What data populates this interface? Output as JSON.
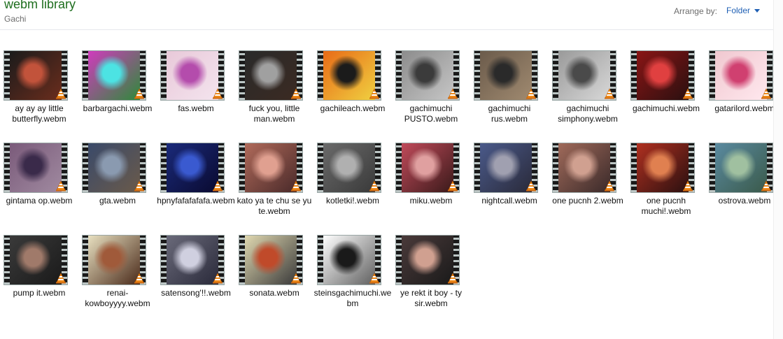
{
  "header": {
    "title": "webm library",
    "subtitle": "Gachi",
    "arrange_label": "Arrange by:",
    "arrange_value": "Folder"
  },
  "items": [
    {
      "label": "ay ay ay little butterfly.webm",
      "colors": [
        "#1b1b1b",
        "#c2533b",
        "#6b2d1d"
      ]
    },
    {
      "label": "barbargachi.webm",
      "colors": [
        "#d03bbd",
        "#4ce3e3",
        "#2e8a3a"
      ]
    },
    {
      "label": "fas.webm",
      "colors": [
        "#e8c9d9",
        "#b44cac",
        "#f4e4ee"
      ]
    },
    {
      "label": "fuck you, little man.webm",
      "colors": [
        "#2a2a2a",
        "#a0a0a0",
        "#3b2a22"
      ]
    },
    {
      "label": "gachileach.webm",
      "colors": [
        "#e86a17",
        "#1b1b1b",
        "#f0d040"
      ]
    },
    {
      "label": "gachimuchi PUSTO.webm",
      "colors": [
        "#8c8c8c",
        "#3b3b3b",
        "#c6c6c6"
      ]
    },
    {
      "label": "gachimuchi rus.webm",
      "colors": [
        "#6b5b4b",
        "#2a2a2a",
        "#a08a70"
      ]
    },
    {
      "label": "gachimuchi simphony.webm",
      "colors": [
        "#9a9a9a",
        "#4a4a4a",
        "#d8d8d8"
      ]
    },
    {
      "label": "gachimuchi.webm",
      "colors": [
        "#8a1515",
        "#e04040",
        "#2a1010"
      ]
    },
    {
      "label": "gatarilord.webm",
      "colors": [
        "#f0c8d0",
        "#d04070",
        "#ffe8ee"
      ]
    },
    {
      "label": "gintama op.webm",
      "colors": [
        "#7a5a7a",
        "#3a2a4a",
        "#a08aa0"
      ]
    },
    {
      "label": "gta.webm",
      "colors": [
        "#3a4a6a",
        "#8a9ab0",
        "#6a5a4a"
      ]
    },
    {
      "label": "hpnyfafafafafa.webm",
      "colors": [
        "#1a2a7a",
        "#3a5ad0",
        "#0a0a30"
      ]
    },
    {
      "label": "kato ya te chu se yu te.webm",
      "colors": [
        "#b06a5a",
        "#e0a090",
        "#4a2a2a"
      ]
    },
    {
      "label": "kotletki!.webm",
      "colors": [
        "#6a6a6a",
        "#b0b0b0",
        "#3a3a3a"
      ]
    },
    {
      "label": "miku.webm",
      "colors": [
        "#c04a5a",
        "#e0a0a0",
        "#3a1a1a"
      ]
    },
    {
      "label": "nightcall.webm",
      "colors": [
        "#4a5a8a",
        "#a0a0b0",
        "#2a2a3a"
      ]
    },
    {
      "label": "one pucnh 2.webm",
      "colors": [
        "#a06a5a",
        "#d0a090",
        "#3a2a2a"
      ]
    },
    {
      "label": "one pucnh muchi!.webm",
      "colors": [
        "#b03020",
        "#e08050",
        "#2a1010"
      ]
    },
    {
      "label": "ostrova.webm",
      "colors": [
        "#5a8aa0",
        "#a0c0a0",
        "#3a5a4a"
      ]
    },
    {
      "label": "pump it.webm",
      "colors": [
        "#3a3a3a",
        "#a07a6a",
        "#1a1a1a"
      ]
    },
    {
      "label": "renai-kowboyyyy.webm",
      "colors": [
        "#e8e0c0",
        "#a05a3a",
        "#4a2a1a"
      ]
    },
    {
      "label": "satensong'!!.webm",
      "colors": [
        "#6a6a7a",
        "#d0d0e0",
        "#2a2a3a"
      ]
    },
    {
      "label": "sonata.webm",
      "colors": [
        "#e0d8b0",
        "#c04a2a",
        "#3a3a3a"
      ]
    },
    {
      "label": "steinsgachimuchi.webm",
      "colors": [
        "#ffffff",
        "#1a1a1a",
        "#606060"
      ]
    },
    {
      "label": "ye rekt it boy - ty sir.webm",
      "colors": [
        "#4a3a3a",
        "#d0a090",
        "#1a1a1a"
      ]
    }
  ]
}
